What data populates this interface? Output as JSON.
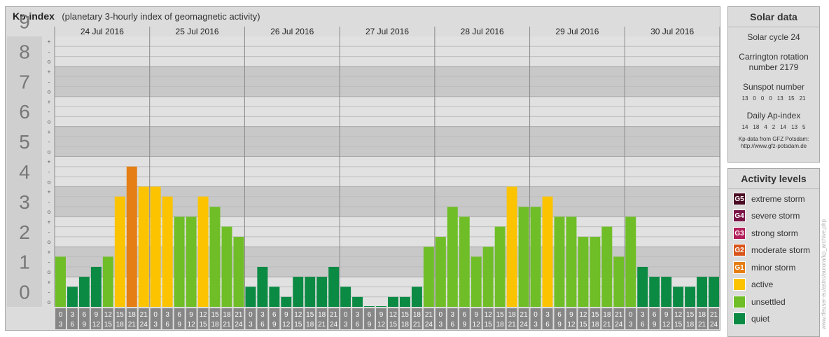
{
  "title": "Kp-index",
  "subtitle": "(planetary 3-hourly index of geomagnetic activity)",
  "chart_data": {
    "type": "bar",
    "title": "Kp-index",
    "subtitle": "(planetary 3-hourly index of geomagnetic activity)",
    "ylim": [
      0,
      9
    ],
    "y_ticks": [
      "0",
      "1",
      "2",
      "3",
      "4",
      "5",
      "6",
      "7",
      "8",
      "9"
    ],
    "sub_ticks": [
      "o",
      "-",
      "+"
    ],
    "days": [
      "24 Jul 2016",
      "25 Jul 2016",
      "26 Jul 2016",
      "27 Jul 2016",
      "28 Jul 2016",
      "29 Jul 2016",
      "30 Jul 2016"
    ],
    "interval_start": [
      "0",
      "3",
      "6",
      "9",
      "12",
      "15",
      "18",
      "21"
    ],
    "interval_end": [
      "3",
      "6",
      "9",
      "12",
      "15",
      "18",
      "21",
      "24"
    ],
    "values": [
      1.67,
      0.67,
      1.0,
      1.33,
      1.67,
      3.67,
      4.67,
      4.0,
      4.0,
      3.67,
      3.0,
      3.0,
      3.67,
      3.33,
      2.67,
      2.33,
      0.67,
      1.33,
      0.67,
      0.33,
      1.0,
      1.0,
      1.0,
      1.33,
      0.67,
      0.33,
      0.0,
      0.0,
      0.33,
      0.33,
      0.67,
      2.0,
      2.33,
      3.33,
      3.0,
      1.67,
      2.0,
      2.67,
      4.0,
      3.33,
      3.33,
      3.67,
      3.0,
      3.0,
      2.33,
      2.33,
      2.67,
      1.67,
      3.0,
      1.33,
      1.0,
      1.0,
      0.67,
      0.67,
      1.0,
      1.0
    ],
    "level_colors": {
      "quiet": "#0b8a44",
      "unsettled": "#6fbe27",
      "active": "#fbc300",
      "minor_storm": "#e57e14"
    },
    "grid": true
  },
  "solar": {
    "title": "Solar data",
    "cycle": "Solar cycle 24",
    "carrington_line1": "Carrington rotation",
    "carrington_line2": "number 2179",
    "sunspot_label": "Sunspot number",
    "sunspot_values": [
      "13",
      "0",
      "0",
      "0",
      "13",
      "15",
      "21"
    ],
    "ap_label": "Daily Ap-index",
    "ap_values": [
      "14",
      "18",
      "4",
      "2",
      "14",
      "13",
      "5"
    ],
    "credit_line1": "Kp-data from GFZ Potsdam:",
    "credit_line2": "http://www.gfz-potsdam.de"
  },
  "activity": {
    "title": "Activity levels",
    "levels": [
      {
        "badge": "G5",
        "label": "extreme storm",
        "color": "#4a0a22"
      },
      {
        "badge": "G4",
        "label": "severe storm",
        "color": "#7a1346"
      },
      {
        "badge": "G3",
        "label": "strong storm",
        "color": "#b21f5a"
      },
      {
        "badge": "G2",
        "label": "moderate storm",
        "color": "#d8541a"
      },
      {
        "badge": "G1",
        "label": "minor storm",
        "color": "#e57e14"
      },
      {
        "badge": "",
        "label": "active",
        "color": "#fbc300"
      },
      {
        "badge": "",
        "label": "unsettled",
        "color": "#6fbe27"
      },
      {
        "badge": "",
        "label": "quiet",
        "color": "#0b8a44"
      }
    ]
  },
  "watermark": "www.tfeuser-eu/astro/aurora/kp_archive.php"
}
